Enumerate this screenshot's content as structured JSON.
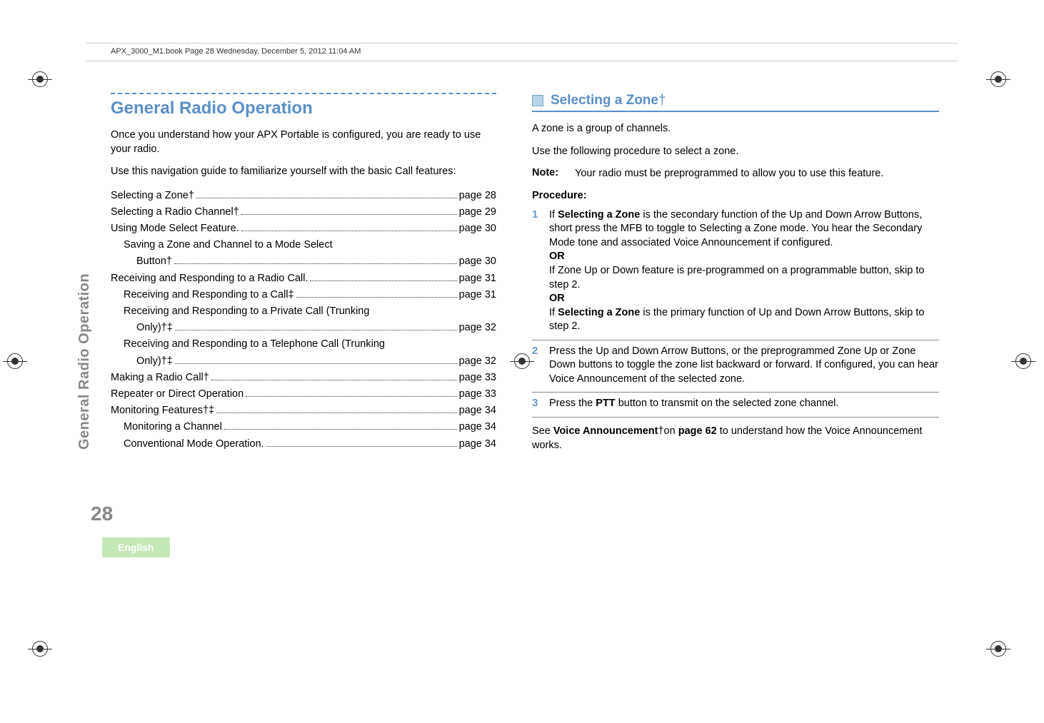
{
  "header": {
    "book_info": "APX_3000_M1.book  Page 28  Wednesday, December 5, 2012  11:04 AM"
  },
  "left": {
    "section_title": "General Radio Operation",
    "intro1": "Once you understand how your APX Portable is configured, you are ready to use your radio.",
    "intro2": "Use this navigation guide to familiarize yourself with the basic Call features:",
    "toc": [
      {
        "label": "Selecting a Zone†",
        "page": "page 28",
        "indent": 0
      },
      {
        "label": "Selecting a Radio Channel†",
        "page": "page 29",
        "indent": 0
      },
      {
        "label": "Using Mode Select Feature.",
        "page": "page 30",
        "indent": 0
      },
      {
        "label": "Saving a Zone and Channel to a Mode Select",
        "page": "",
        "indent": 1,
        "nowrap_continue": true
      },
      {
        "label": "Button†",
        "page": "page 30",
        "indent": 2
      },
      {
        "label": "Receiving and Responding to a Radio Call.",
        "page": "page 31",
        "indent": 0
      },
      {
        "label": "Receiving and Responding to a Call‡",
        "page": "page 31",
        "indent": 1
      },
      {
        "label": "Receiving and Responding to a Private Call (Trunking",
        "page": "",
        "indent": 1,
        "nowrap_continue": true
      },
      {
        "label": "Only)†‡",
        "page": "page 32",
        "indent": 2
      },
      {
        "label": "Receiving and Responding to a Telephone Call (Trunking",
        "page": "",
        "indent": 1,
        "nowrap_continue": true
      },
      {
        "label": "Only)†‡",
        "page": "page 32",
        "indent": 2
      },
      {
        "label": "Making a Radio Call†",
        "page": "page 33",
        "indent": 0
      },
      {
        "label": "Repeater or Direct Operation",
        "page": "page 33",
        "indent": 0
      },
      {
        "label": "Monitoring Features†‡",
        "page": "page 34",
        "indent": 0
      },
      {
        "label": "Monitoring a Channel",
        "page": "page 34",
        "indent": 1
      },
      {
        "label": "Conventional Mode Operation.",
        "page": "page 34",
        "indent": 1
      }
    ],
    "vertical_label": "General Radio Operation",
    "page_number": "28",
    "language": "English"
  },
  "right": {
    "heading": "Selecting a Zone",
    "heading_dagger": "†",
    "p1": "A zone is a group of channels.",
    "p2": "Use the following procedure to select a zone.",
    "note_label": "Note:",
    "note_text": "Your radio must be preprogrammed to allow you to use this feature.",
    "procedure_label": "Procedure:",
    "steps": {
      "s1": {
        "num": "1",
        "t1a": "If ",
        "t1b": "Selecting a Zone",
        "t1c": " is the secondary function of the Up and Down Arrow Buttons, short press the MFB to toggle to Selecting a Zone mode. You hear the Secondary Mode tone and associated Voice Announcement if configured.",
        "or1": "OR",
        "t2": "If Zone Up or Down feature is pre-programmed on a programmable button, skip to step 2.",
        "or2": "OR",
        "t3a": "If ",
        "t3b": "Selecting a Zone",
        "t3c": " is the primary function of Up and Down Arrow Buttons, skip to step 2."
      },
      "s2": {
        "num": "2",
        "text": "Press the Up and Down Arrow Buttons, or the preprogrammed Zone Up or Zone Down buttons to toggle the zone list backward or forward. If configured, you can hear Voice Announcement of the selected zone."
      },
      "s3": {
        "num": "3",
        "t1": "Press the ",
        "t2": "PTT",
        "t3": " button to transmit on the selected zone channel."
      }
    },
    "footer": {
      "t1": "See ",
      "t2": "Voice Announcement",
      "t3": "†on ",
      "t4": "page 62",
      "t5": " to understand how the Voice Announcement works."
    }
  }
}
